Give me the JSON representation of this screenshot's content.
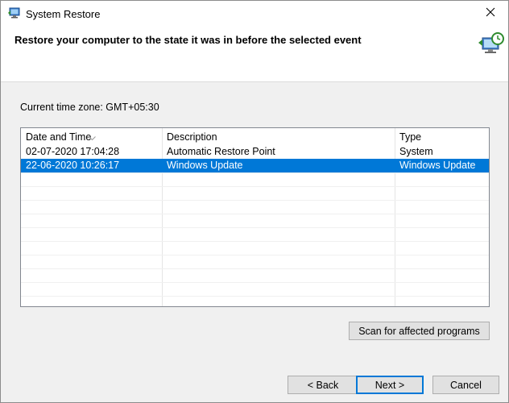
{
  "window": {
    "title": "System Restore",
    "close_glyph": "✕"
  },
  "header": {
    "instruction": "Restore your computer to the state it was in before the selected event",
    "icon": "system-restore-icon"
  },
  "timezone": {
    "label": "Current time zone: GMT+05:30"
  },
  "restore_list": {
    "columns": [
      "Date and Time",
      "Description",
      "Type"
    ],
    "sort_indicator": "chevron-down-icon",
    "rows": [
      {
        "date": "02-07-2020 17:04:28",
        "description": "Automatic Restore Point",
        "type": "System",
        "selected": false
      },
      {
        "date": "22-06-2020 10:26:17",
        "description": "Windows Update",
        "type": "Windows Update",
        "selected": true
      }
    ],
    "selection_color": "#0078d7"
  },
  "buttons": {
    "scan": "Scan for affected programs",
    "back": "< Back",
    "next": "Next >",
    "cancel": "Cancel"
  }
}
